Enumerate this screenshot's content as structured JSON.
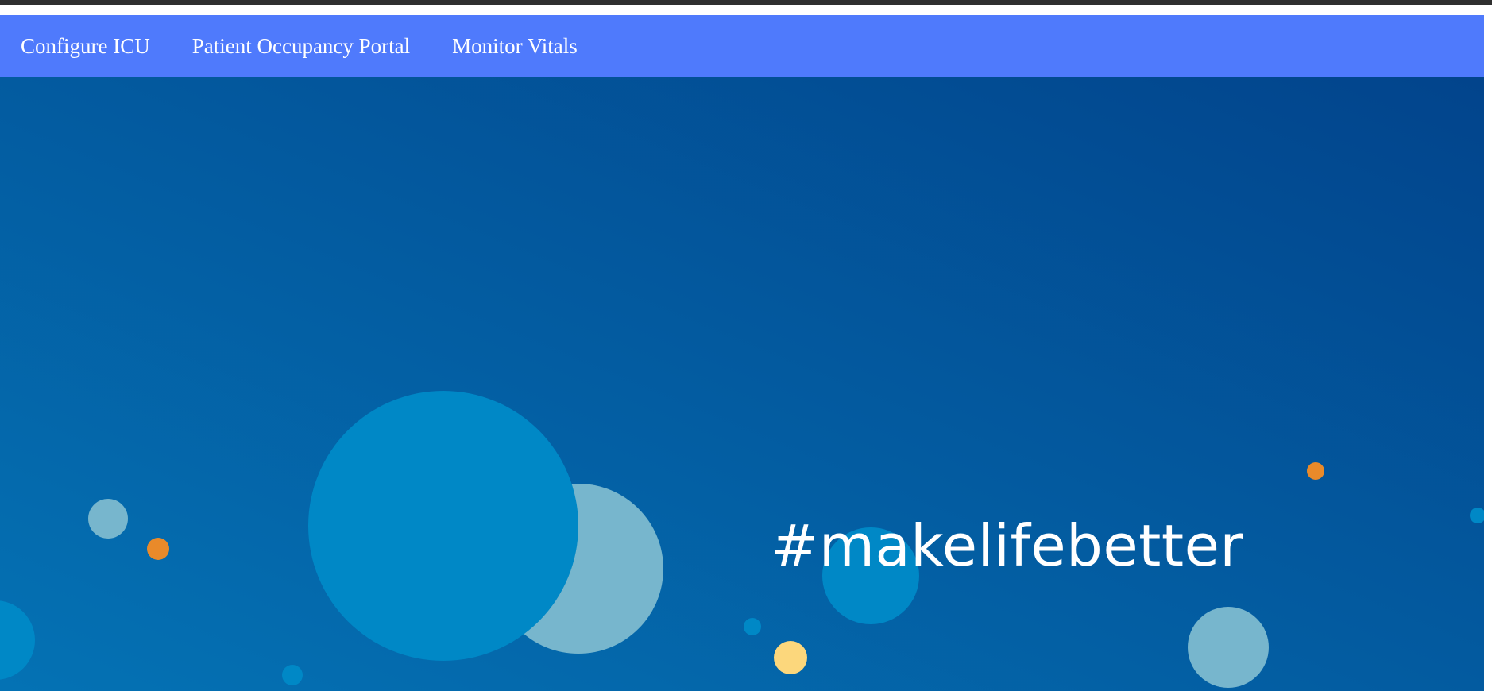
{
  "nav": {
    "background": "#4f7afc",
    "items": [
      {
        "label": "Configure ICU"
      },
      {
        "label": "Patient Occupancy Portal"
      },
      {
        "label": "Monitor Vitals"
      }
    ]
  },
  "hero": {
    "tagline": "#makelifebetter",
    "colors": {
      "gradient_start": "#0472b4",
      "gradient_end": "#02448c",
      "bubble_blue": "#0088c6",
      "bubble_light": "#77b6cd",
      "bubble_orange": "#e98a2a",
      "bubble_yellow": "#fcd77c"
    }
  }
}
